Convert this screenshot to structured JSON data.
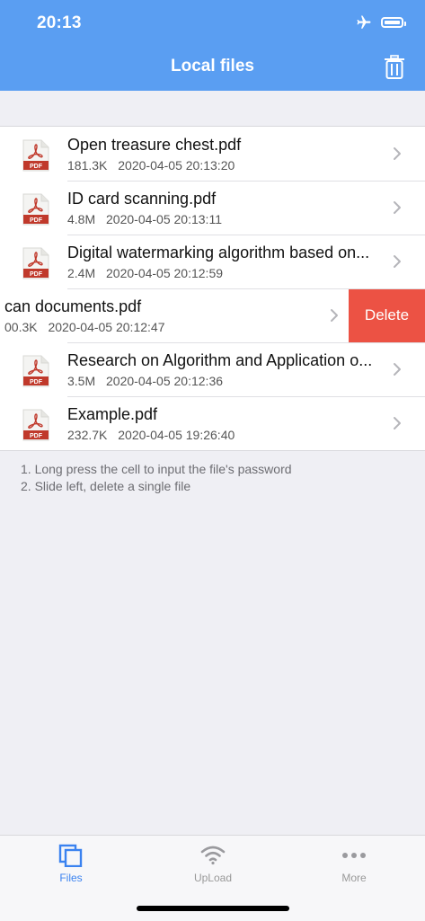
{
  "status": {
    "time": "20:13"
  },
  "header": {
    "title": "Local files"
  },
  "files": [
    {
      "name": "Open treasure chest.pdf",
      "size": "181.3K",
      "date": "2020-04-05 20:13:20"
    },
    {
      "name": "ID card scanning.pdf",
      "size": "4.8M",
      "date": "2020-04-05 20:13:11"
    },
    {
      "name": "Digital watermarking algorithm based on...",
      "size": "2.4M",
      "date": "2020-04-05 20:12:59"
    },
    {
      "name": "can documents.pdf",
      "size": "00.3K",
      "date": "2020-04-05 20:12:47",
      "swiped": true
    },
    {
      "name": "Research on Algorithm and Application o...",
      "size": "3.5M",
      "date": "2020-04-05 20:12:36"
    },
    {
      "name": "Example.pdf",
      "size": "232.7K",
      "date": "2020-04-05 19:26:40"
    }
  ],
  "delete_label": "Delete",
  "pdf_badge": "PDF",
  "notes": [
    "1. Long press the cell to input the file's password",
    "2. Slide left, delete a single file"
  ],
  "tabs": [
    {
      "label": "Files",
      "icon": "files-icon",
      "active": true
    },
    {
      "label": "UpLoad",
      "icon": "wifi-icon",
      "active": false
    },
    {
      "label": "More",
      "icon": "more-dots-icon",
      "active": false
    }
  ],
  "colors": {
    "header": "#5a9ef2",
    "delete": "#ec5244",
    "accent": "#3a82f0",
    "pdf_red": "#c0392b"
  }
}
